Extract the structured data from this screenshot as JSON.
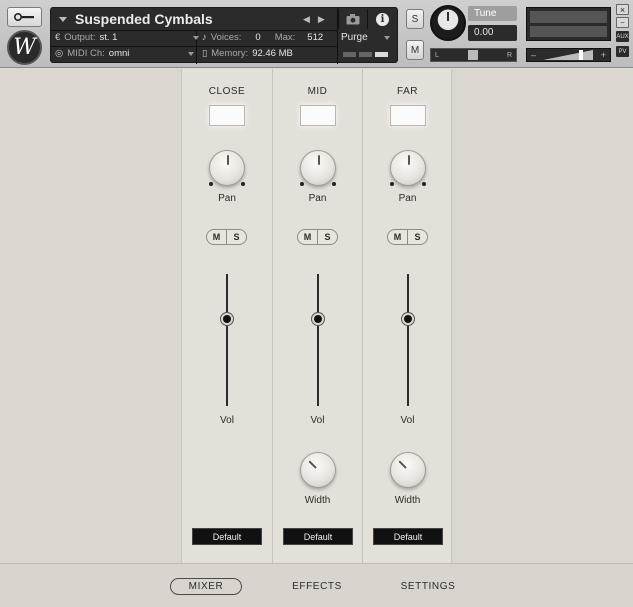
{
  "header": {
    "instrument_name": "Suspended Cymbals",
    "output_label": "Output:",
    "output_value": "st. 1",
    "voices_label": "Voices:",
    "voices_value": "0",
    "max_label": "Max:",
    "max_value": "512",
    "midi_label": "MIDI Ch:",
    "midi_value": "omni",
    "memory_label": "Memory:",
    "memory_value": "92.46 MB",
    "purge_label": "Purge",
    "solo_label": "S",
    "mute_label": "M",
    "tune_label": "Tune",
    "tune_value": "0.00",
    "pan_left": "L",
    "pan_right": "R",
    "vol_minus": "–",
    "vol_plus": "+",
    "aux_label": "AUX",
    "pv_label": "PV",
    "close_label": "×",
    "logo_letter": "W"
  },
  "strips": [
    {
      "title": "CLOSE",
      "pan_label": "Pan",
      "vol_label": "Vol",
      "preset": "Default"
    },
    {
      "title": "MID",
      "pan_label": "Pan",
      "vol_label": "Vol",
      "width_label": "Width",
      "preset": "Default"
    },
    {
      "title": "FAR",
      "pan_label": "Pan",
      "vol_label": "Vol",
      "width_label": "Width",
      "preset": "Default"
    }
  ],
  "ms": {
    "m": "M",
    "s": "S"
  },
  "tabs": {
    "mixer": "MIXER",
    "effects": "EFFECTS",
    "settings": "SETTINGS",
    "active": "MIXER"
  },
  "colors": {
    "panel_bg": "#dbd6cf",
    "strip_bg": "#e3dfd9",
    "header_dark": "#2b2b2b"
  }
}
